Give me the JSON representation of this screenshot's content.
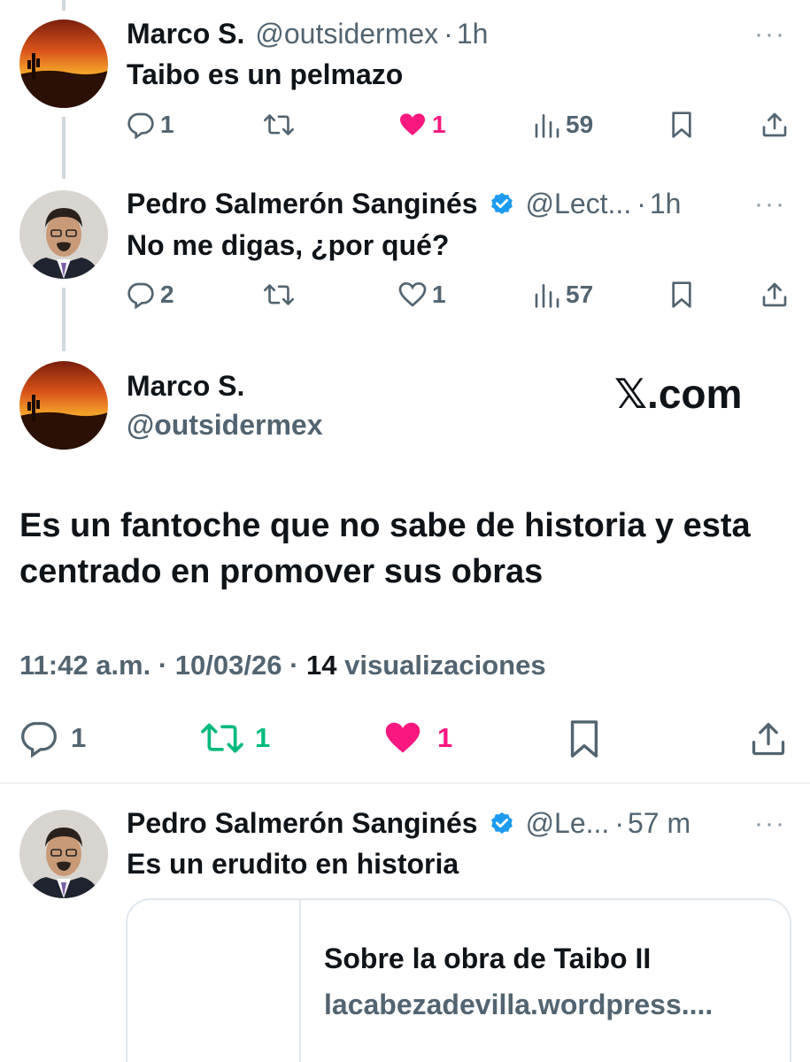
{
  "tweets": [
    {
      "name": "Marco S.",
      "handle": "@outsidermex",
      "time": "1h",
      "text": "Taibo es un pelmazo",
      "replies": "1",
      "likes": "1",
      "views": "59"
    },
    {
      "name": "Pedro Salmerón Sanginés",
      "handle": "@Lect...",
      "time": "1h",
      "text": "No me digas, ¿por qué?",
      "replies": "2",
      "likes": "1",
      "views": "57"
    }
  ],
  "main_tweet": {
    "name": "Marco S.",
    "handle": "@outsidermex",
    "watermark": "𝕏.com",
    "text": "Es un fantoche que no sabe de historia y esta centrado en promover sus obras",
    "time": "11:42 a.m.",
    "date": "10/03/26",
    "views_count": "14",
    "views_label": "visualizaciones",
    "replies": "1",
    "retweets": "1",
    "likes": "1"
  },
  "reply": {
    "name": "Pedro Salmerón Sanginés",
    "handle": "@Le...",
    "time": "57 m",
    "text": "Es un erudito en historia",
    "card_title": "Sobre la obra de Taibo II",
    "card_url": "lacabezadevilla.wordpress...."
  },
  "separators": {
    "dot": "·",
    "more": "···"
  },
  "colors": {
    "like": "#f91880",
    "retweet": "#00ba7c",
    "verified": "#1d9bf0",
    "muted": "#536471"
  }
}
